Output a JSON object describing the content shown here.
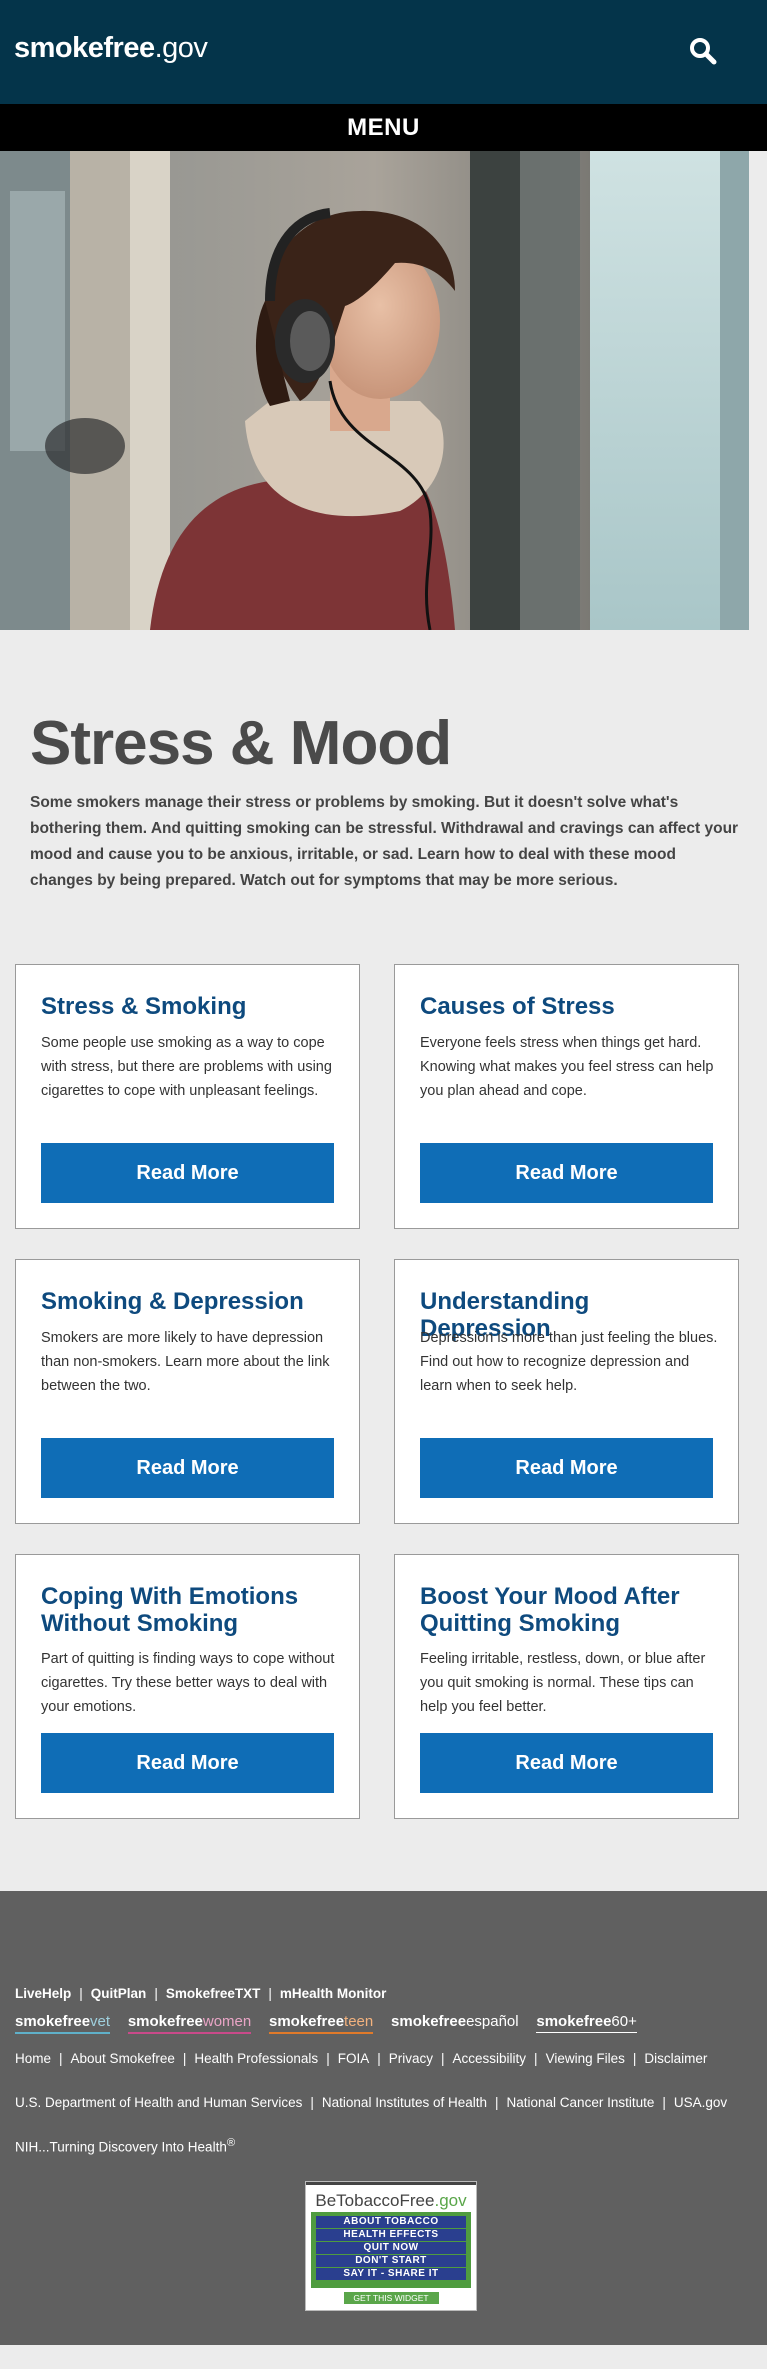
{
  "header": {
    "logo_bold": "smokefree",
    "logo_light": ".gov",
    "menu_label": "MENU"
  },
  "page": {
    "title": "Stress & Mood",
    "lead": "Some smokers manage their stress or problems by smoking. But it doesn't solve what's bothering them. And quitting smoking can be stressful. Withdrawal and cravings can affect your mood and cause you to be anxious, irritable, or sad. Learn how to deal with these mood changes by being prepared. Watch out for symptoms that may be more serious."
  },
  "cards": [
    {
      "title": "Stress & Smoking",
      "text": "Some people use smoking as a way to cope with stress, but there are problems with using cigarettes to cope with unpleasant feelings.",
      "button": "Read More"
    },
    {
      "title": "Causes of Stress",
      "text": "Everyone feels stress when things get hard. Knowing what makes you feel stress can help you plan ahead and cope.",
      "button": "Read More"
    },
    {
      "title": "Smoking & Depression",
      "text": "Smokers are more likely to have depression than non-smokers. Learn more about the link between the two.",
      "button": "Read More"
    },
    {
      "title": "Understanding Depression",
      "text": "Depression is more than just feeling the blues. Find out how to recognize depression and learn when to seek help.",
      "button": "Read More"
    },
    {
      "title": "Coping With Emotions Without Smoking",
      "text": "Part of quitting is finding ways to cope without cigarettes. Try these better ways to deal with your emotions.",
      "button": "Read More"
    },
    {
      "title": "Boost Your Mood After Quitting Smoking",
      "text": "Feeling irritable, restless, down, or blue after you quit smoking is normal. These tips can help you feel better.",
      "button": "Read More"
    }
  ],
  "footer": {
    "programs": [
      "LiveHelp",
      "QuitPlan",
      "SmokefreeTXT",
      "mHealth Monitor"
    ],
    "brands": [
      {
        "bold": "smokefree",
        "light": "vet",
        "color": "#5fb0c9"
      },
      {
        "bold": "smokefree",
        "light": "women",
        "color": "#c94a8a"
      },
      {
        "bold": "smokefree",
        "light": "teen",
        "color": "#e07a2a"
      },
      {
        "bold": "smokefree",
        "light": "español",
        "color": "#606060"
      },
      {
        "bold": "smokefree",
        "light": "60+",
        "color": "#ffffff"
      }
    ],
    "links": [
      "Home",
      "About Smokefree",
      "Health Professionals",
      "FOIA",
      "Privacy",
      "Accessibility",
      "Viewing Files",
      "Disclaimer"
    ],
    "agencies": [
      "U.S. Department of Health and Human Services",
      "National Institutes of Health",
      "National Cancer Institute",
      "USA.gov"
    ],
    "tagline": "NIH...Turning Discovery Into Health",
    "tagline_mark": "®",
    "widget": {
      "title_main": "BeTobaccoFree",
      "title_suffix": ".gov",
      "items": [
        "ABOUT TOBACCO",
        "HEALTH EFFECTS",
        "QUIT NOW",
        "DON'T START",
        "SAY IT - SHARE IT"
      ],
      "get": "GET THIS WIDGET"
    }
  }
}
